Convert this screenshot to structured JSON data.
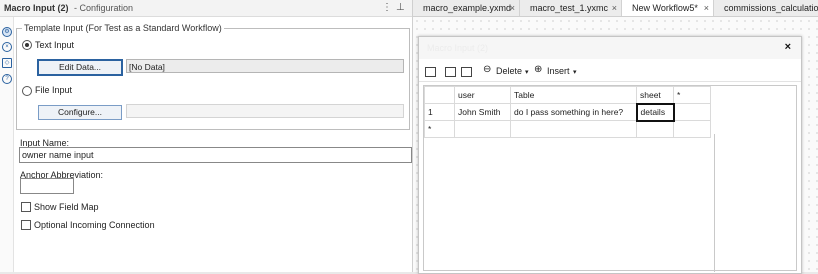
{
  "header": {
    "title": "Macro Input (2)",
    "subtitle": " - Configuration"
  },
  "template": {
    "group_label": "Template Input (For Test as a Standard Workflow)",
    "text_input_label": "Text Input",
    "edit_button": "Edit Data...",
    "edit_value": "[No Data]",
    "file_input_label": "File Input",
    "configure_button": "Configure..."
  },
  "input_name": {
    "label": "Input Name:",
    "value": "owner name input"
  },
  "anchor": {
    "label": "Anchor Abbreviation:",
    "value": ""
  },
  "options": {
    "show_field_map": "Show Field Map",
    "optional_incoming": "Optional Incoming Connection"
  },
  "tabs": [
    {
      "label": "macro_example.yxmd"
    },
    {
      "label": "macro_test_1.yxmc"
    },
    {
      "label": "New Workflow5*"
    },
    {
      "label": "commissions_calculation"
    }
  ],
  "dialog": {
    "title": "Macro Input (2)",
    "delete_label": "Delete",
    "insert_label": "Insert",
    "columns": [
      "",
      "user",
      "Table",
      "sheet",
      "*"
    ],
    "rows": [
      [
        "1",
        "John Smith",
        "do I pass something in here?",
        "details",
        ""
      ],
      [
        "*",
        "",
        "",
        "",
        ""
      ]
    ]
  }
}
